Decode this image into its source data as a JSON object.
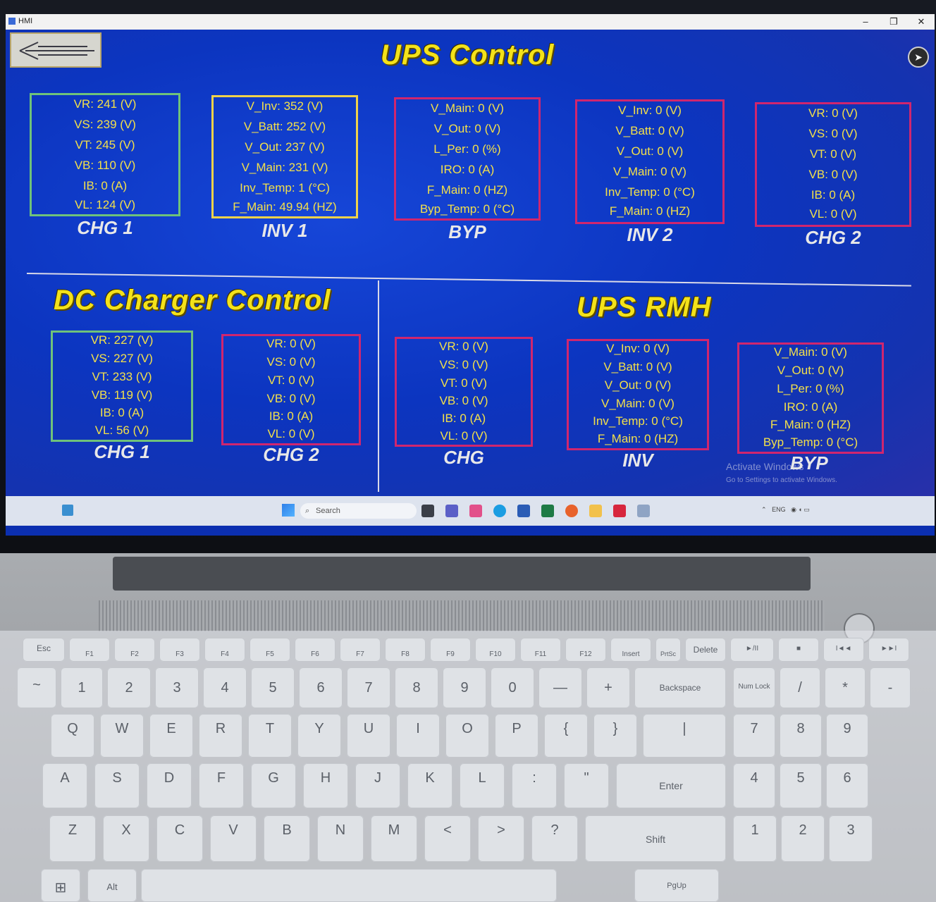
{
  "window": {
    "title": "HMI",
    "controls": [
      "–",
      "❐",
      "✕"
    ]
  },
  "ups_control": {
    "title": "UPS Control",
    "panels": [
      {
        "label": "CHG 1",
        "rows": [
          "VR: 241  (V)",
          "VS: 239  (V)",
          "VT: 245  (V)",
          "VB: 110  (V)",
          "IB: 0  (A)",
          "VL: 124 (V)"
        ]
      },
      {
        "label": "INV 1",
        "rows": [
          "V_Inv: 352  (V)",
          "V_Batt: 252  (V)",
          "V_Out: 237  (V)",
          "V_Main: 231  (V)",
          "Inv_Temp: 1  (°C)",
          "F_Main: 49.94  (HZ)"
        ]
      },
      {
        "label": "BYP",
        "rows": [
          "V_Main: 0  (V)",
          "V_Out: 0  (V)",
          "L_Per: 0  (%)",
          "IRO: 0  (A)",
          "F_Main: 0  (HZ)",
          "Byp_Temp: 0  (°C)"
        ]
      },
      {
        "label": "INV 2",
        "rows": [
          "V_Inv: 0  (V)",
          "V_Batt: 0  (V)",
          "V_Out: 0  (V)",
          "V_Main: 0  (V)",
          "Inv_Temp: 0  (°C)",
          "F_Main: 0  (HZ)"
        ]
      },
      {
        "label": "CHG 2",
        "rows": [
          "VR: 0  (V)",
          "VS: 0  (V)",
          "VT: 0  (V)",
          "VB: 0  (V)",
          "IB: 0  (A)",
          "VL: 0 (V)"
        ]
      }
    ]
  },
  "dc_charger_control": {
    "title": "DC Charger Control",
    "panels": [
      {
        "label": "CHG 1",
        "rows": [
          "VR: 227  (V)",
          "VS: 227  (V)",
          "VT: 233  (V)",
          "VB: 119  (V)",
          "IB: 0  (A)",
          "VL: 56 (V)"
        ]
      },
      {
        "label": "CHG 2",
        "rows": [
          "VR: 0  (V)",
          "VS: 0  (V)",
          "VT: 0  (V)",
          "VB: 0  (V)",
          "IB: 0  (A)",
          "VL: 0 (V)"
        ]
      }
    ]
  },
  "ups_rmh": {
    "title": "UPS RMH",
    "panels": [
      {
        "label": "CHG",
        "rows": [
          "VR: 0  (V)",
          "VS: 0  (V)",
          "VT: 0  (V)",
          "VB: 0  (V)",
          "IB: 0  (A)",
          "VL: 0 (V)"
        ]
      },
      {
        "label": "INV",
        "rows": [
          "V_Inv: 0  (V)",
          "V_Batt: 0  (V)",
          "V_Out: 0  (V)",
          "V_Main: 0  (V)",
          "Inv_Temp: 0  (°C)",
          "F_Main: 0  (HZ)"
        ]
      },
      {
        "label": "BYP",
        "rows": [
          "V_Main: 0  (V)",
          "V_Out: 0  (V)",
          "L_Per: 0  (%)",
          "IRO: 0  (A)",
          "F_Main: 0  (HZ)",
          "Byp_Temp: 0  (°C)"
        ]
      }
    ]
  },
  "watermark": {
    "line1": "Activate Windows",
    "line2": "Go to Settings to activate Windows."
  },
  "taskbar": {
    "search_placeholder": "Search",
    "language": "ENG"
  },
  "keyboard": {
    "row1": [
      "Esc",
      "F1",
      "F2",
      "F3",
      "F4",
      "F5",
      "F6",
      "F7",
      "F8",
      "F9",
      "F10",
      "F11",
      "F12",
      "Insert",
      "PrtSc",
      "Delete",
      "►/II",
      "■",
      "I◄◄",
      "►►I"
    ],
    "row2": [
      "~",
      "1",
      "2",
      "3",
      "4",
      "5",
      "6",
      "7",
      "8",
      "9",
      "0",
      "—",
      "+",
      "Backspace",
      "Num Lock",
      "/",
      "*",
      "-"
    ],
    "row3": [
      "Q",
      "W",
      "E",
      "R",
      "T",
      "Y",
      "U",
      "I",
      "O",
      "P",
      "{",
      "}",
      "|",
      "7",
      "8",
      "9"
    ],
    "row4": [
      "A",
      "S",
      "D",
      "F",
      "G",
      "H",
      "J",
      "K",
      "L",
      ":",
      "\"",
      "Enter",
      "4",
      "5",
      "6"
    ],
    "row5": [
      "Z",
      "X",
      "C",
      "V",
      "B",
      "N",
      "M",
      "<",
      ">",
      "?",
      "Shift",
      "1",
      "2",
      "3"
    ],
    "row6": [
      "Alt",
      "PgUp"
    ]
  },
  "colors": {
    "screen_bg": "#0b2fb0",
    "title_yellow": "#f4e21a",
    "value_yellow": "#f3e04a",
    "border_green": "#6fc27a",
    "border_yellow": "#f0d24a",
    "border_red": "#d0266e"
  }
}
